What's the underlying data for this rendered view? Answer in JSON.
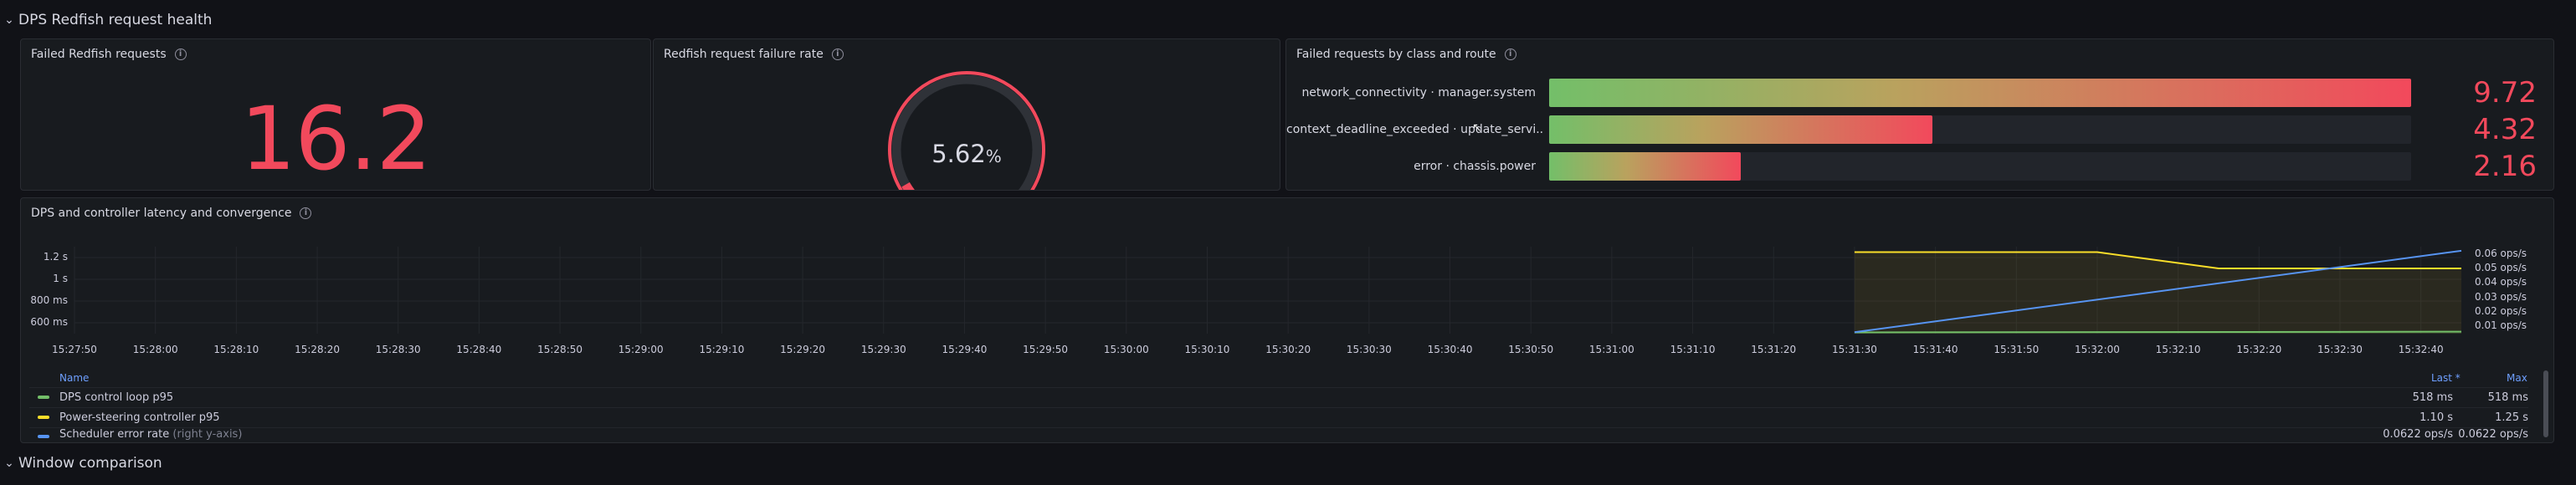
{
  "rows": {
    "top": {
      "title": "DPS Redfish request health"
    },
    "bottom": {
      "title": "Window comparison"
    }
  },
  "stat_panel": {
    "title": "Failed Redfish requests",
    "value": "16.2",
    "color": "#f2495c"
  },
  "gauge_panel": {
    "title": "Redfish request failure rate",
    "value": "5.62",
    "unit": "%",
    "fraction": 0.0562,
    "color": "#f2495c"
  },
  "bar_panel": {
    "title": "Failed requests by class and route",
    "max": 9.72,
    "rows": [
      {
        "label": "network_connectivity · manager.system",
        "value": "9.72",
        "num": 9.72
      },
      {
        "label": "context_deadline_exceeded · update_servi...",
        "value": "4.32",
        "num": 4.32
      },
      {
        "label": "error · chassis.power",
        "value": "2.16",
        "num": 2.16
      }
    ]
  },
  "timeseries_panel": {
    "title": "DPS and controller latency and convergence",
    "y_left_ticks": [
      "1.2 s",
      "1 s",
      "800 ms",
      "600 ms"
    ],
    "y_right_ticks": [
      "0.06 ops/s",
      "0.05 ops/s",
      "0.04 ops/s",
      "0.03 ops/s",
      "0.02 ops/s",
      "0.01 ops/s"
    ],
    "x_ticks": [
      "15:27:50",
      "15:28:00",
      "15:28:10",
      "15:28:20",
      "15:28:30",
      "15:28:40",
      "15:28:50",
      "15:29:00",
      "15:29:10",
      "15:29:20",
      "15:29:30",
      "15:29:40",
      "15:29:50",
      "15:30:00",
      "15:30:10",
      "15:30:20",
      "15:30:30",
      "15:30:40",
      "15:30:50",
      "15:31:00",
      "15:31:10",
      "15:31:20",
      "15:31:30",
      "15:31:40",
      "15:31:50",
      "15:32:00",
      "15:32:10",
      "15:32:20",
      "15:32:30",
      "15:32:40"
    ],
    "legend": {
      "header_name": "Name",
      "header_last": "Last *",
      "header_max": "Max",
      "rows": [
        {
          "name": "DPS control loop p95",
          "suffix": "",
          "last": "518 ms",
          "max": "518 ms",
          "color": "#73bf69"
        },
        {
          "name": "Power-steering controller p95",
          "suffix": "",
          "last": "1.10 s",
          "max": "1.25 s",
          "color": "#fade2a"
        },
        {
          "name": "Scheduler error rate",
          "suffix": "(right y-axis)",
          "last": "0.0622 ops/s",
          "max": "0.0622 ops/s",
          "color": "#5794f2"
        }
      ]
    }
  },
  "chart_data": {
    "type": "line",
    "title": "DPS and controller latency and convergence",
    "x_range": [
      "15:27:50",
      "15:32:45"
    ],
    "y_left_range_s": [
      0.5,
      1.3
    ],
    "y_right_range_ops": [
      0.005,
      0.065
    ],
    "series": [
      {
        "name": "DPS control loop p95",
        "axis": "left",
        "color": "#73bf69",
        "x": [
          "15:31:30",
          "15:32:45"
        ],
        "y": [
          0.512,
          0.518
        ]
      },
      {
        "name": "Power-steering controller p95",
        "axis": "left",
        "color": "#fade2a",
        "x": [
          "15:31:30",
          "15:32:00",
          "15:32:15",
          "15:32:45"
        ],
        "y": [
          1.25,
          1.25,
          1.1,
          1.1
        ]
      },
      {
        "name": "Scheduler error rate",
        "axis": "right",
        "color": "#5794f2",
        "x": [
          "15:31:30",
          "15:32:45"
        ],
        "y": [
          0.006,
          0.0622
        ]
      }
    ]
  }
}
